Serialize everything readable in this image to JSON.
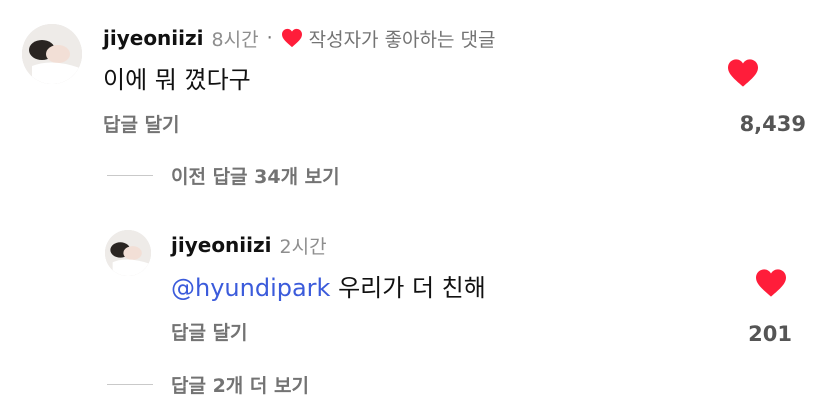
{
  "comments": [
    {
      "username": "jiyeoniizi",
      "time": "8시간",
      "separator": "·",
      "liked_by_author": "작성자가 좋아하는 댓글",
      "text": "이에 뭐 꼈다구",
      "reply_label": "답글 달기",
      "likes": "8,439",
      "view_replies": "이전 답글 34개 보기"
    },
    {
      "username": "jiyeoniizi",
      "time": "2시간",
      "mention": "@hyundipark",
      "text": " 우리가 더 친해",
      "reply_label": "답글 달기",
      "likes": "201",
      "view_more_replies": "답글 2개 더 보기"
    }
  ],
  "colors": {
    "heart": "#ff1d3a",
    "mention": "#3b5bdb",
    "muted": "#737373"
  }
}
